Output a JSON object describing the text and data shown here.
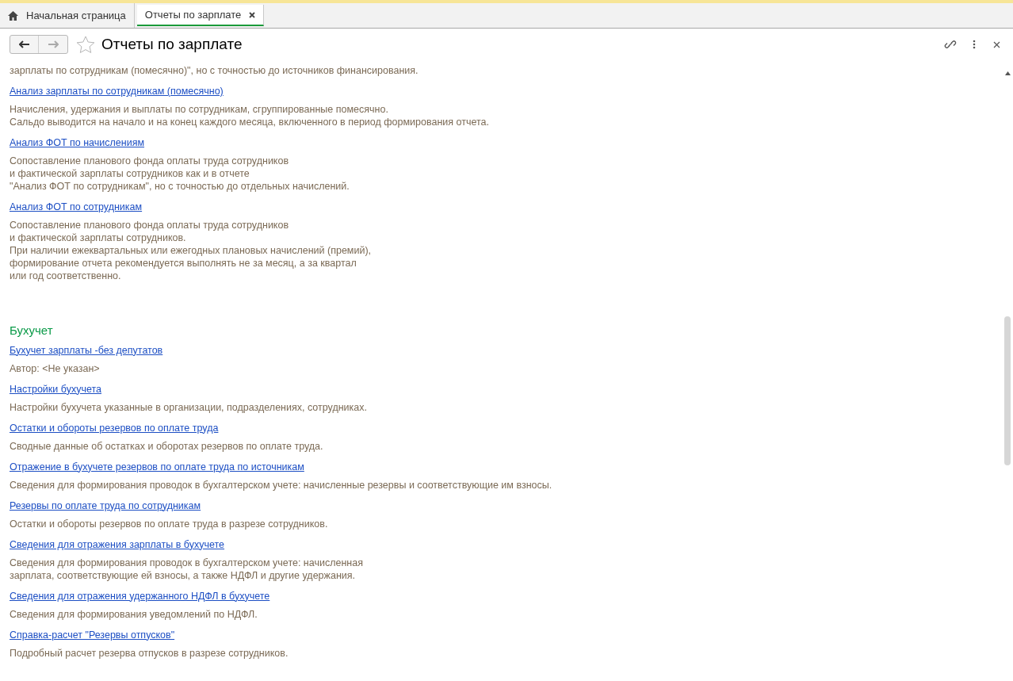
{
  "tabs": [
    {
      "label": "Начальная страница",
      "kind": "home",
      "selected": false
    },
    {
      "label": "Отчеты по зарплате",
      "kind": "doc",
      "selected": true
    }
  ],
  "page_title": "Отчеты по зарплате",
  "leading_text": "зарплаты по сотрудникам (помесячно)\", но с точностью до источников финансирования.",
  "sections": [
    {
      "reports": [
        {
          "title": "Анализ зарплаты по сотрудникам (помесячно)",
          "description": [
            "Начисления, удержания и выплаты по сотрудникам, сгруппированные помесячно.",
            "Сальдо выводится на начало и на конец каждого месяца, включенного в период формирования отчета."
          ]
        },
        {
          "title": "Анализ ФОТ по начислениям",
          "description": [
            "Сопоставление планового фонда оплаты труда сотрудников",
            "и фактической зарплаты сотрудников как и в отчете",
            "\"Анализ ФОТ по сотрудникам\", но с точностью до отдельных начислений."
          ]
        },
        {
          "title": "Анализ ФОТ по сотрудникам",
          "description": [
            "Сопоставление планового фонда оплаты труда сотрудников",
            "и фактической зарплаты сотрудников.",
            "При наличии ежеквартальных или ежегодных плановых начислений (премий),",
            "формирование отчета рекомендуется выполнять не за месяц, а за квартал",
            "или год соответственно."
          ]
        }
      ]
    },
    {
      "heading": "Бухучет",
      "reports": [
        {
          "title": "Бухучет зарплаты -без депутатов",
          "description": [
            "Автор: <Не указан>"
          ]
        },
        {
          "title": "Настройки бухучета",
          "description": [
            "Настройки бухучета указанные в организации, подразделениях, сотрудниках."
          ]
        },
        {
          "title": "Остатки и обороты резервов по оплате труда",
          "description": [
            "Сводные данные об остатках и оборотах резервов по оплате труда."
          ]
        },
        {
          "title": "Отражение в бухучете резервов по оплате труда по источникам",
          "description": [
            "Сведения для формирования проводок в бухгалтерском учете: начисленные резервы и соответствующие им взносы."
          ]
        },
        {
          "title": "Резервы по оплате труда по сотрудникам",
          "description": [
            "Остатки и обороты резервов по оплате труда в разрезе сотрудников."
          ]
        },
        {
          "title": "Сведения для отражения зарплаты в бухучете",
          "description": [
            "Сведения для формирования проводок в бухгалтерском учете: начисленная",
            "зарплата, соответствующие ей взносы, а также НДФЛ и другие удержания."
          ]
        },
        {
          "title": "Сведения для отражения удержанного НДФЛ в бухучете",
          "description": [
            "Сведения для формирования уведомлений по НДФЛ."
          ]
        },
        {
          "title": "Справка-расчет \"Резервы отпусков\"",
          "description": [
            "Подробный расчет резерва отпусков в разрезе сотрудников."
          ]
        }
      ]
    }
  ]
}
